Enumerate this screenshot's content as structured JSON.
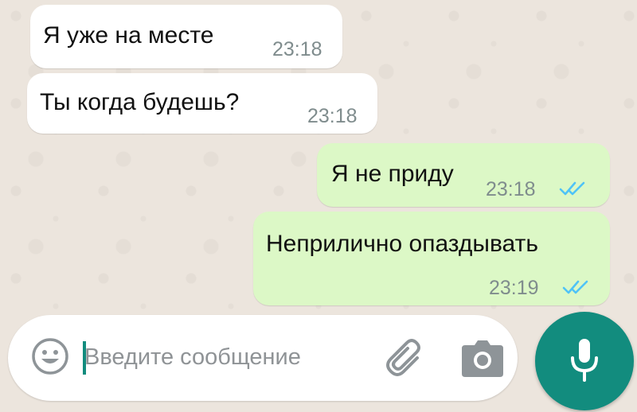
{
  "chat": {
    "messages": [
      {
        "direction": "incoming",
        "text": "Я уже на месте",
        "time": "23:18"
      },
      {
        "direction": "incoming",
        "text": "Ты когда будешь?",
        "time": "23:18"
      },
      {
        "direction": "outgoing",
        "text": "Я не приду",
        "time": "23:18",
        "status": "read"
      },
      {
        "direction": "outgoing",
        "text": "Неприлично опаздывать",
        "time": "23:19",
        "status": "read"
      }
    ]
  },
  "composer": {
    "placeholder": "Введите сообщение",
    "value": "",
    "emoji_icon": "emoji-icon",
    "attach_icon": "paperclip-icon",
    "camera_icon": "camera-icon",
    "send_icon": "microphone-icon"
  },
  "colors": {
    "accent": "#128c7e",
    "outgoing_bubble": "#dcf8c6",
    "incoming_bubble": "#ffffff",
    "read_ticks": "#4fc3f7",
    "wallpaper": "#ece5dd"
  }
}
